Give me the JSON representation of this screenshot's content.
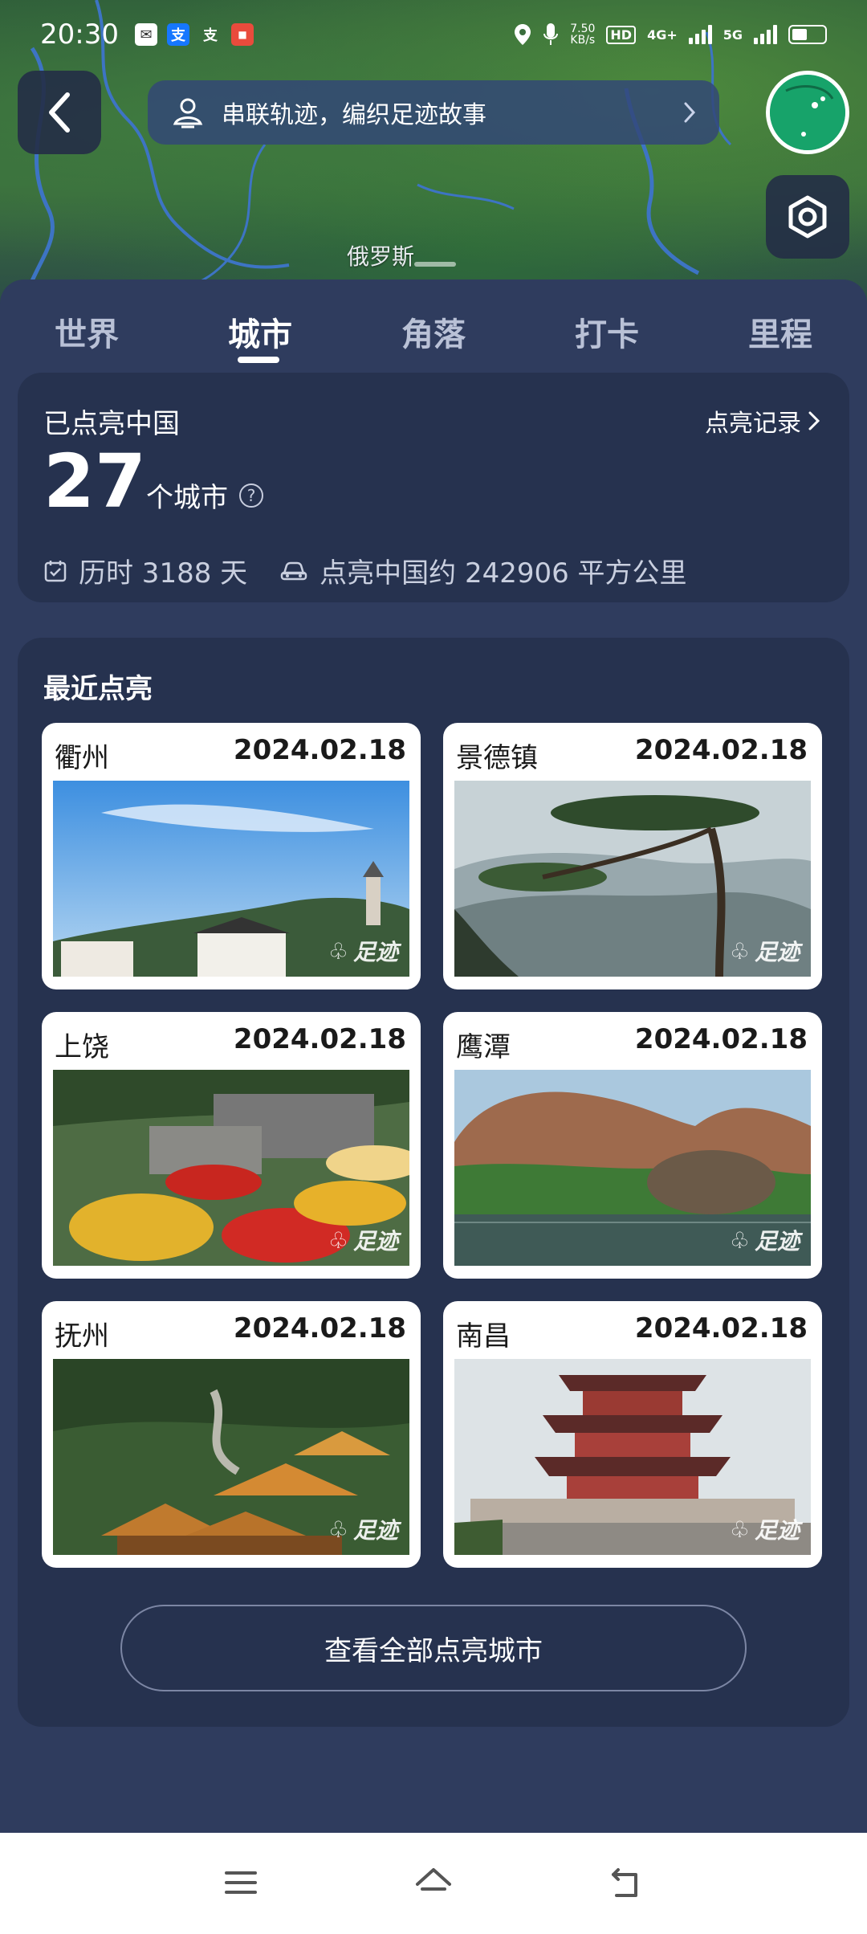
{
  "status_bar": {
    "time": "20:30",
    "net_speed": "7.50\nKB/s",
    "hd": "HD",
    "net_4g": "4G+",
    "net_5g": "5G",
    "icons": [
      "mail-icon",
      "alipay-icon",
      "alipay-mini-icon",
      "app-icon",
      "location-icon",
      "mic-icon",
      "signal-icon",
      "battery-icon"
    ]
  },
  "map": {
    "label": "俄罗斯"
  },
  "banner": {
    "text": "串联轨迹，编织足迹故事"
  },
  "tabs": [
    {
      "label": "世界"
    },
    {
      "label": "城市"
    },
    {
      "label": "角落"
    },
    {
      "label": "打卡"
    },
    {
      "label": "里程"
    }
  ],
  "active_tab": "城市",
  "summary": {
    "title": "已点亮中国",
    "record_link": "点亮记录",
    "count": "27",
    "unit": "个城市",
    "days": "历时 3188 天",
    "area": "点亮中国约 242906 平方公里"
  },
  "recent": {
    "title": "最近点亮",
    "watermark": "足迹",
    "cards": [
      {
        "name": "衢州",
        "date": "2024.02.18"
      },
      {
        "name": "景德镇",
        "date": "2024.02.18"
      },
      {
        "name": "上饶",
        "date": "2024.02.18"
      },
      {
        "name": "鹰潭",
        "date": "2024.02.18"
      },
      {
        "name": "抚州",
        "date": "2024.02.18"
      },
      {
        "name": "南昌",
        "date": "2024.02.18"
      }
    ],
    "view_all": "查看全部点亮城市"
  },
  "colors": {
    "panel": "#2f3c5e",
    "card_bg": "#26324f",
    "accent_white": "#ffffff"
  }
}
